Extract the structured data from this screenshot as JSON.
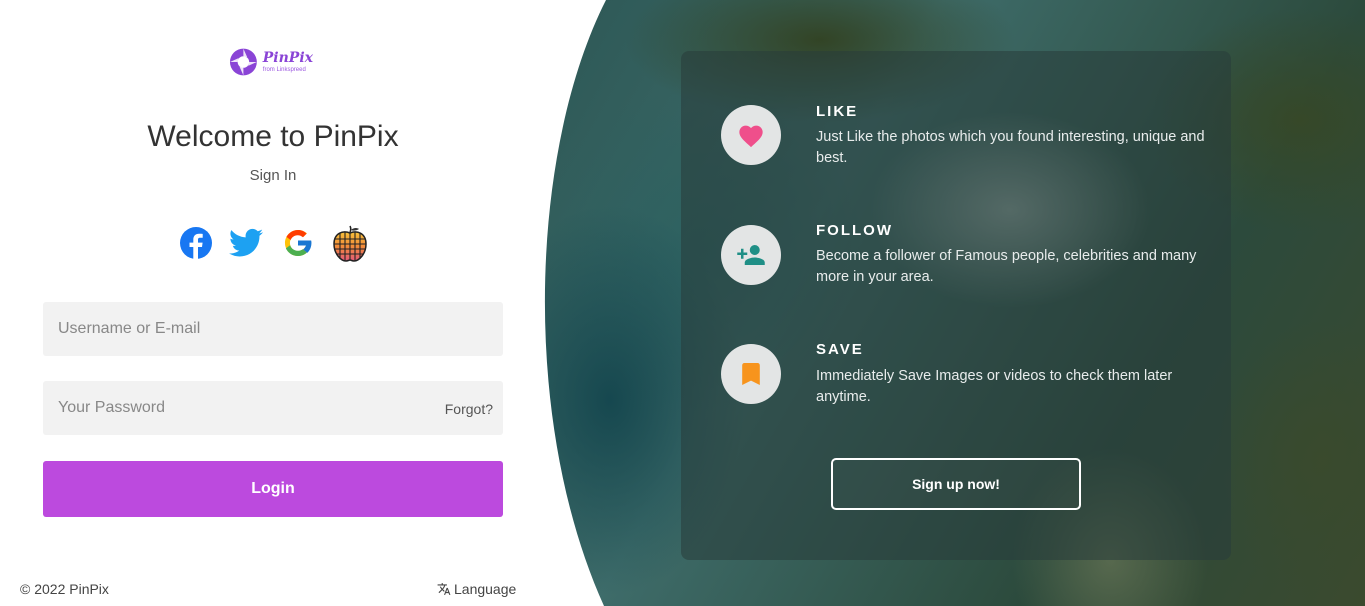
{
  "brand": {
    "name": "PinPix",
    "tagline": "from Linkspreed",
    "accent_color": "#bc4ade"
  },
  "login": {
    "welcome": "Welcome to PinPix",
    "subtitle": "Sign In",
    "social": [
      {
        "name": "facebook-icon",
        "color": "#1877f2"
      },
      {
        "name": "twitter-icon",
        "color": "#1da1f2"
      },
      {
        "name": "google-icon",
        "color": "#ea4335"
      },
      {
        "name": "grid-apple-icon",
        "color": "#f0a040"
      }
    ],
    "username_placeholder": "Username or E-mail",
    "password_placeholder": "Your Password",
    "forgot_label": "Forgot?",
    "login_label": "Login"
  },
  "footer": {
    "copyright": "© 2022 PinPix",
    "language_label": "Language",
    "language_icon": "translate-icon"
  },
  "features": [
    {
      "title": "LIKE",
      "description": "Just Like the photos which you found interesting, unique and best.",
      "icon": "heart-icon",
      "icon_color": "#ef4f8b"
    },
    {
      "title": "FOLLOW",
      "description": "Become a follower of Famous people, celebrities and many more in your area.",
      "icon": "person-add-icon",
      "icon_color": "#1f8f86"
    },
    {
      "title": "SAVE",
      "description": "Immediately Save Images or videos to check them later anytime.",
      "icon": "bookmark-icon",
      "icon_color": "#f7941d"
    }
  ],
  "signup_label": "Sign up now!"
}
